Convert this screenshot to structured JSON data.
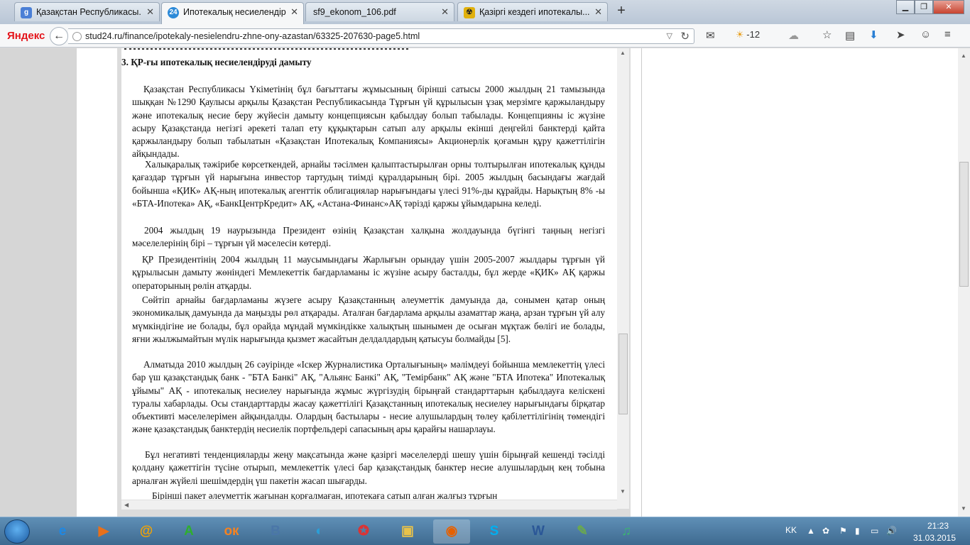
{
  "tabs": [
    {
      "label": "Қазақстан Республикасы...",
      "icon": "google-icon",
      "color": "#4a7fd6"
    },
    {
      "label": "Ипотекалық несиелендір...",
      "icon": "stud24-icon",
      "color": "#2d8ad8"
    },
    {
      "label": "sf9_ekonom_106.pdf",
      "icon": "pdf-icon",
      "color": "#c33"
    },
    {
      "label": "Қазіргі кездегі ипотекалы...",
      "icon": "radiation-icon",
      "color": "#e1b10d"
    }
  ],
  "toolbar": {
    "logo": "Яндекс",
    "url": "stud24.ru/finance/ipotekaly-nesielendru-zhne-ony-azastan/63325-207630-page5.html",
    "temperature": "-12"
  },
  "document": {
    "heading": "3. ҚР-ғы ипотекалық несиелендіруді дамыту",
    "paragraphs": [
      "Қазақстан Республикасы Үкіметінің бұл бағыттағы жұмысының бірінші сатысы 2000 жылдың 21 тамызында шыққан №1290 Қаулысы арқылы Қазақстан Республикасында Тұрғын үй құрылысын ұзақ мерзімге қаржыландыру және ипотекалық несие беру жүйесін дамыту концепциясын қабылдау болып табылады. Концепцияны іс жүзіне асыру Қазақстанда негізгі әрекеті талап ету құқықтарын сатып алу арқылы екінші деңгейлі банктерді қайта қаржыландыру болып табылатын «Қазақстан Ипотекалық Компаниясы» Акционерлік қоғамын құру қажеттілігін айқындады.",
      "Халықаралық тәжірибе көрсеткендей, арнайы тәсілмен қалыптастырылған орны толтырылған ипотекалық құнды қағаздар тұрғын үй нарығына инвестор тартудың тиімді құралдарының бірі. 2005 жылдың басындағы жағдай бойынша «ҚИК» АҚ-ның ипотекалық агенттік облигациялар нарығындағы үлесі 91%-ды құрайды. Нарықтың 8% -ы «БТА-Ипотека» АҚ, «БанкЦентрКредит» АҚ, «Астана-Финанс»АҚ тәрізді қаржы ұйымдарына келеді.",
      "2004 жылдың 19 наурызында Президент өзінің Қазақстан халқына жолдауында бүгінгі таңның негізгі мәселелерінің бірі – тұрғын үй мәселесін көтерді.",
      "ҚР Президентінің 2004 жылдың 11 маусымындағы Жарлығын орындау үшін 2005-2007 жылдары тұрғын үй құрылысын дамыту жөніндегі Мемлекеттік бағдарламаны іс жүзіне асыру басталды, бұл жерде «ҚИК» АҚ қаржы операторының рөлін атқарды.",
      "Сөйтіп арнайы бағдарламаны жүзеге асыру Қазақстанның әлеуметтік дамуында да, сонымен қатар оның экономикалық дамуында да маңызды рөл атқарады. Аталған бағдарлама арқылы азаматтар жаңа, арзан тұрғын үй алу мүмкіндігіне ие болады, бұл орайда мұндай мүмкіндікке халықтың шынымен де осыған мұқтаж бөлігі ие болады, яғни жылжымайтын мүлік нарығында қызмет жасайтын делдалдардың қатысуы болмайды [5].",
      "Алматыда 2010 жылдың 26 сәуірінде «Іскер Журналистика Орталығының» мәлімдеуі бойынша мемлекеттің үлесі бар үш қазақстандық банк - \"БТА Банкі\" АҚ, \"Альянс Банкі\" АҚ, \"Темірбанк\" АҚ және \"БТА Ипотека\" Ипотекалық ұйымы\" АҚ - ипотекалық несиелеу нарығында жұмыс жүргізудің бірыңғай стандарттарын қабылдауға келіскені туралы хабарлады. Осы стандарттарды жасау қажеттілігі Қазақстанның ипотекалық несиелеу нарығындағы бірқатар объективті мәселелерімен айқындалды. Олардың бастылары - несие алушылардың төлеу қабілеттілігінің төмендігі және қазақстандық банктердің несиелік портфельдері сапасының ары қарайғы нашарлауы.",
      "Бұл негативті тенденцияларды жеңу мақсатында және қазіргі мәселелерді шешу үшін бірыңғай кешенді тәсілді қолдану қажеттігін түсіне отырып, мемлекеттік үлесі бар қазақстандық банктер несие алушылардың кең тобына арналған жүйелі шешімдердің үш пакетін жасап шығарды.",
      "Бірінші пакет әлеуметтік жағынан қорғалмаған, ипотекаға сатып алған жалғыз тұрғын"
    ]
  },
  "taskbar": {
    "apps": [
      {
        "name": "internet-explorer",
        "glyph": "e",
        "color": "#1e88e5"
      },
      {
        "name": "media-player",
        "glyph": "▶",
        "color": "#e8701a"
      },
      {
        "name": "mail-agent",
        "glyph": "@",
        "color": "#f6a400"
      },
      {
        "name": "green-app",
        "glyph": "A",
        "color": "#2fae2f"
      },
      {
        "name": "odnoklassniki",
        "glyph": "ок",
        "color": "#f58220"
      },
      {
        "name": "vkontakte",
        "glyph": "В",
        "color": "#4a76a8"
      },
      {
        "name": "agent-app",
        "glyph": "◐",
        "color": "#2a9fd8"
      },
      {
        "name": "spinner-app",
        "glyph": "✪",
        "color": "#d33"
      },
      {
        "name": "file-explorer",
        "glyph": "▣",
        "color": "#e8c24a"
      },
      {
        "name": "firefox",
        "glyph": "◉",
        "color": "#e66000"
      },
      {
        "name": "skype",
        "glyph": "S",
        "color": "#00aff0"
      },
      {
        "name": "word",
        "glyph": "W",
        "color": "#2b5797"
      },
      {
        "name": "paint",
        "glyph": "✎",
        "color": "#6aa84f"
      },
      {
        "name": "music-app",
        "glyph": "♫",
        "color": "#3cb371"
      }
    ],
    "language": "KK",
    "time": "21:23",
    "date": "31.03.2015"
  }
}
